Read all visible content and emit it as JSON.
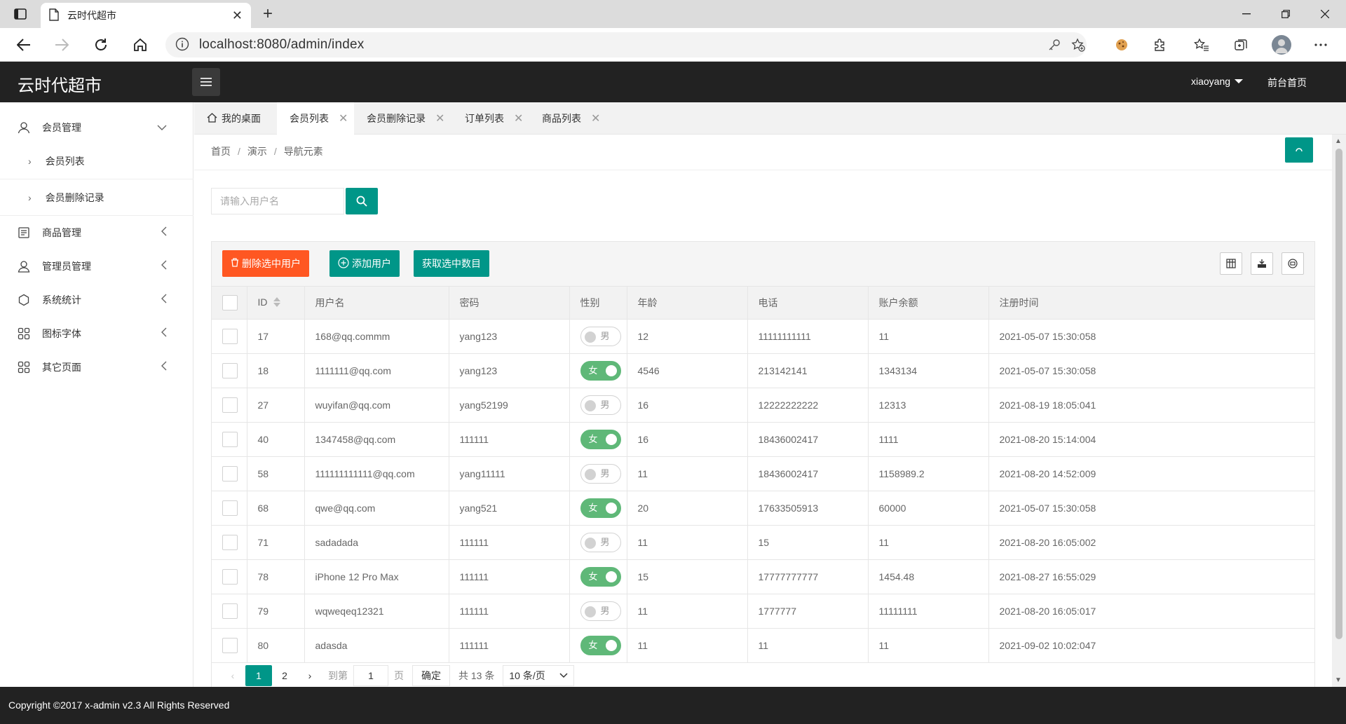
{
  "browser": {
    "tab_title": "云时代超市",
    "url": "localhost:8080/admin/index"
  },
  "app": {
    "logo": "云时代超市",
    "username": "xiaoyang",
    "front_link": "前台首页"
  },
  "sidebar": {
    "groups": [
      {
        "label": "会员管理",
        "icon": "user-icon"
      },
      {
        "label": "商品管理",
        "icon": "goods-icon"
      },
      {
        "label": "管理员管理",
        "icon": "admin-icon"
      },
      {
        "label": "系统统计",
        "icon": "stats-icon"
      },
      {
        "label": "图标字体",
        "icon": "grid-icon"
      },
      {
        "label": "其它页面",
        "icon": "grid-icon"
      }
    ],
    "sub_items": [
      "会员列表",
      "会员删除记录"
    ]
  },
  "page_tabs": [
    "我的桌面",
    "会员列表",
    "会员删除记录",
    "订单列表",
    "商品列表"
  ],
  "breadcrumb": [
    "首页",
    "演示",
    "导航元素"
  ],
  "search": {
    "placeholder": "请输入用户名"
  },
  "toolbar": {
    "delete_label": "删除选中用户",
    "add_label": "添加用户",
    "count_label": "获取选中数目"
  },
  "table": {
    "columns": [
      "ID",
      "用户名",
      "密码",
      "性别",
      "年龄",
      "电话",
      "账户余额",
      "注册时间"
    ],
    "rows": [
      {
        "id": "17",
        "username": "168@qq.commm",
        "password": "yang123",
        "gender": "男",
        "female": false,
        "age": "12",
        "phone": "11111111111",
        "balance": "11",
        "time": "2021-05-07 15:30:058"
      },
      {
        "id": "18",
        "username": "1111111@qq.com",
        "password": "yang123",
        "gender": "女",
        "female": true,
        "age": "4546",
        "phone": "213142141",
        "balance": "1343134",
        "time": "2021-05-07 15:30:058"
      },
      {
        "id": "27",
        "username": "wuyifan@qq.com",
        "password": "yang52199",
        "gender": "男",
        "female": false,
        "age": "16",
        "phone": "12222222222",
        "balance": "12313",
        "time": "2021-08-19 18:05:041"
      },
      {
        "id": "40",
        "username": "1347458@qq.com",
        "password": "111111",
        "gender": "女",
        "female": true,
        "age": "16",
        "phone": "18436002417",
        "balance": "1111",
        "time": "2021-08-20 15:14:004"
      },
      {
        "id": "58",
        "username": "111111111111@qq.com",
        "password": "yang11111",
        "gender": "男",
        "female": false,
        "age": "11",
        "phone": "18436002417",
        "balance": "1158989.2",
        "time": "2021-08-20 14:52:009"
      },
      {
        "id": "68",
        "username": "qwe@qq.com",
        "password": "yang521",
        "gender": "女",
        "female": true,
        "age": "20",
        "phone": "17633505913",
        "balance": "60000",
        "time": "2021-05-07 15:30:058"
      },
      {
        "id": "71",
        "username": "sadadada",
        "password": "111111",
        "gender": "男",
        "female": false,
        "age": "11",
        "phone": "15",
        "balance": "11",
        "time": "2021-08-20 16:05:002"
      },
      {
        "id": "78",
        "username": "iPhone 12 Pro Max",
        "password": "111111",
        "gender": "女",
        "female": true,
        "age": "15",
        "phone": "17777777777",
        "balance": "1454.48",
        "time": "2021-08-27 16:55:029"
      },
      {
        "id": "79",
        "username": "wqweqeq12321",
        "password": "111111",
        "gender": "男",
        "female": false,
        "age": "11",
        "phone": "1777777",
        "balance": "11111111",
        "time": "2021-08-20 16:05:017"
      },
      {
        "id": "80",
        "username": "adasda",
        "password": "111111",
        "gender": "女",
        "female": true,
        "age": "11",
        "phone": "11",
        "balance": "11",
        "time": "2021-09-02 10:02:047"
      }
    ]
  },
  "pager": {
    "pages": [
      "1",
      "2"
    ],
    "goto_label": "到第",
    "goto_value": "1",
    "page_unit": "页",
    "confirm_label": "确定",
    "total_label": "共 13 条",
    "limit_label": "10 条/页"
  },
  "footer": {
    "text": "Copyright ©2017 x-admin v2.3 All Rights Reserved"
  },
  "colors": {
    "primary": "#009688",
    "danger": "#ff5722",
    "switch_on": "#5fb878",
    "header": "#222222"
  }
}
